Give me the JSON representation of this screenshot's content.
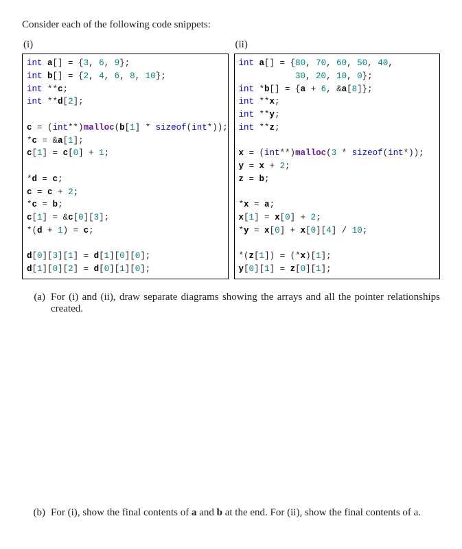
{
  "intro": "Consider each of the following code snippets:",
  "left_label": "(i)",
  "right_label": "(ii)",
  "code_left": {
    "l1": "int a[] = {3, 6, 9};",
    "l2": "int b[] = {2, 4, 6, 8, 10};",
    "l3": "int **c;",
    "l4": "int **d[2];",
    "l5": "",
    "l6": "c = (int**)malloc(b[1] * sizeof(int*));",
    "l7": "*c = &a[1];",
    "l8": "c[1] = c[0] + 1;",
    "l9": "",
    "l10": "*d = c;",
    "l11": "c = c + 2;",
    "l12": "*c = b;",
    "l13": "c[1] = &c[0][3];",
    "l14": "*(d + 1) = c;",
    "l15": "",
    "l16": "d[0][3][1] = d[1][0][0];",
    "l17": "d[1][0][2] = d[0][1][0];"
  },
  "code_right": {
    "r1": "int a[] = {80, 70, 60, 50, 40,",
    "r2": "           30, 20, 10, 0};",
    "r3": "int *b[] = {a + 6, &a[8]};",
    "r4": "int **x;",
    "r5": "int **y;",
    "r6": "int **z;",
    "r7": "",
    "r8": "x = (int**)malloc(3 * sizeof(int*));",
    "r9": "y = x + 2;",
    "r10": "z = b;",
    "r11": "",
    "r12": "*x = a;",
    "r13": "x[1] = x[0] + 2;",
    "r14": "*y = x[0] + x[0][4] / 10;",
    "r15": "",
    "r16": "*(z[1]) = (*x)[1];",
    "r17": "y[0][1] = z[0][1];"
  },
  "part_a_label": "(a)",
  "part_a_text_1": "For (i) and (ii), draw separate diagrams showing the arrays and all the pointer relationships created.",
  "part_b_label": "(b)",
  "part_b_text_prefix": "For (i), show the final contents of ",
  "part_b_a": "a",
  "part_b_and": " and ",
  "part_b_b": "b",
  "part_b_mid": " at the end.  For (ii), show the final contents of a."
}
